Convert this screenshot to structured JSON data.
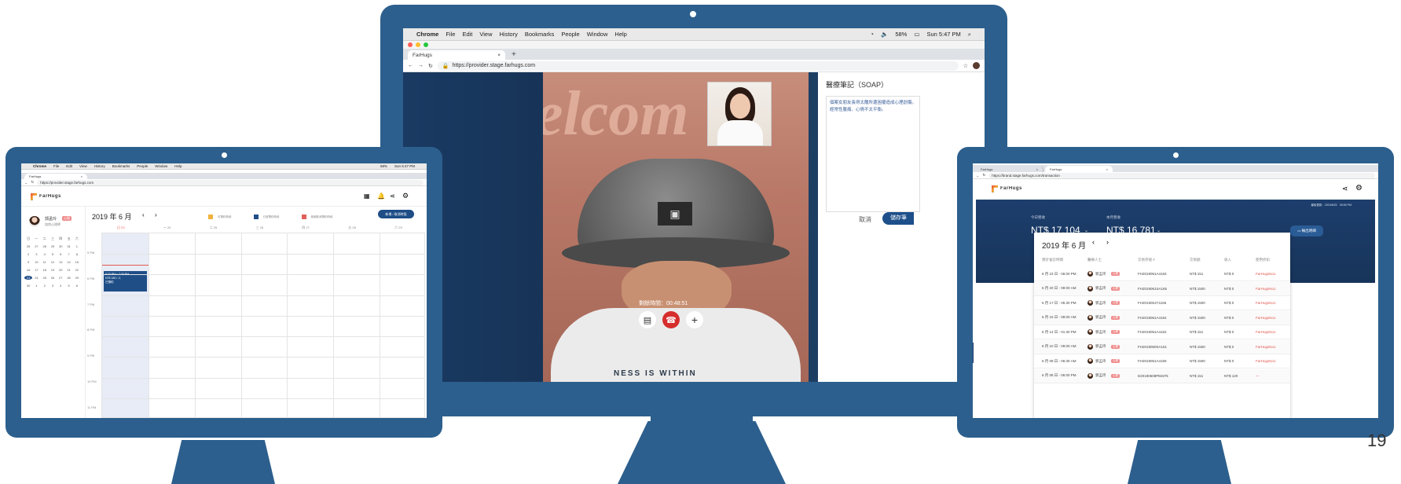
{
  "page_number": "19",
  "menubar": {
    "apple": "",
    "items": [
      "Chrome",
      "File",
      "Edit",
      "View",
      "History",
      "Bookmarks",
      "People",
      "Window",
      "Help"
    ],
    "battery": "58%",
    "clock": "Sun 5:47 PM"
  },
  "center": {
    "tab_label": "FarHugs",
    "url": "https://provider.stage.farhugs.com",
    "call_timer": "剩餘時間：00:48:51",
    "notes_title": "醫療筆記（SOAP）",
    "notes_text": "個案女朋友長得太醜所遭困擾造成心理創傷。經常性腹痛、心情不太平衡。",
    "cancel_label": "取消",
    "save_label": "儲存筆",
    "wall_text": "elcom",
    "cap_text": "▣",
    "shirt_text": "NESS IS WITHIN",
    "colors": {
      "bezel": "#2c5f8d",
      "hangup": "#d62d2d",
      "navy": "#1d3e63"
    }
  },
  "left": {
    "tab_label": "FarHugs",
    "url": "https://provider.stage.farhugs.com",
    "brand": "FarHugs",
    "doctor_name": "郭孟玲",
    "doctor_badge": "心理",
    "doctor_sub": "諮商心理師",
    "month_title": "2019 年 6 月",
    "legend": [
      "可預約時段",
      "已被預約時段",
      "個案取消預約時段"
    ],
    "add_button": "新增 / 取消時段",
    "days": [
      "日 23",
      "一 24",
      "二 25",
      "三 26",
      "四 27",
      "五 28",
      "六 29"
    ],
    "hours": [
      "5 PM",
      "6 PM",
      "7 PM",
      "8 PM",
      "9 PM",
      "10 PM",
      "11 PM"
    ],
    "event_line1": "5:30 PM ~ 7:30 PM",
    "event_line2": "NT$ 180 / 人",
    "event_line3": "已預約",
    "mini_head": [
      "日",
      "一",
      "二",
      "三",
      "四",
      "五",
      "六"
    ],
    "mini_days": [
      "26",
      "27",
      "28",
      "29",
      "30",
      "31",
      "1",
      "2",
      "3",
      "4",
      "5",
      "6",
      "7",
      "8",
      "9",
      "10",
      "11",
      "12",
      "13",
      "14",
      "15",
      "16",
      "17",
      "18",
      "19",
      "20",
      "21",
      "22",
      "23",
      "24",
      "25",
      "26",
      "27",
      "28",
      "29",
      "30",
      "1",
      "2",
      "3",
      "4",
      "5",
      "6"
    ]
  },
  "right": {
    "tab1": "FarHugs",
    "tab2": "FarHugs",
    "url": "https://brand.stage.farhugs.com/transaction",
    "brand": "FarHugs",
    "updated": "最後更新：2019/6/23　05:50 PM",
    "today_label": "今日營收",
    "today_value": "NT$ 17,104",
    "month_label": "本月營收",
    "month_value": "NT$ 16,781",
    "export_label": "輸出明細",
    "month_title": "2019 年 6 月",
    "columns": [
      "預計會診時間",
      "醫療人士",
      "交易序號 #",
      "交易額",
      "收入",
      "使用折扣"
    ],
    "rows": [
      [
        "6 月 23 日 - 06:00 PM",
        "郭孟玲",
        "FH2019061A4163",
        "NT$ 151",
        "NT$ 0",
        "FarHugsNo1"
      ],
      [
        "6 月 20 日 - 08:00 AM",
        "郭孟玲",
        "FH2019061SA165",
        "NT$ 1500",
        "NT$ 0",
        "FarHugsNo1"
      ],
      [
        "6 月 17 日 - 05:30 PM",
        "郭孟玲",
        "FH2019061T4166",
        "NT$ 1500",
        "NT$ 0",
        "FarHugsNo1"
      ],
      [
        "6 月 15 日 - 08:00 AM",
        "郭孟玲",
        "FH2019061A4164",
        "NT$ 1500",
        "NT$ 0",
        "FarHugsNo1"
      ],
      [
        "6 月 14 日 - 01:30 PM",
        "郭孟玲",
        "FH2019061A4162",
        "NT$ 151",
        "NT$ 0",
        "FarHugsNo1"
      ],
      [
        "6 月 10 日 - 09:00 AM",
        "郭孟玲",
        "FH2019060SA161",
        "NT$ 1500",
        "NT$ 0",
        "FarHugsNo1"
      ],
      [
        "6 月 09 日 - 06:30 AM",
        "郭孟玲",
        "FH2019061A4159",
        "NT$ 1500",
        "NT$ 0",
        "FarHugsNo1"
      ],
      [
        "6 月 08 日 - 06:00 PM",
        "郭孟玲",
        "D20190608PEiM7k",
        "NT$ 151",
        "NT$ 120",
        "—"
      ]
    ],
    "badge": "心理"
  }
}
